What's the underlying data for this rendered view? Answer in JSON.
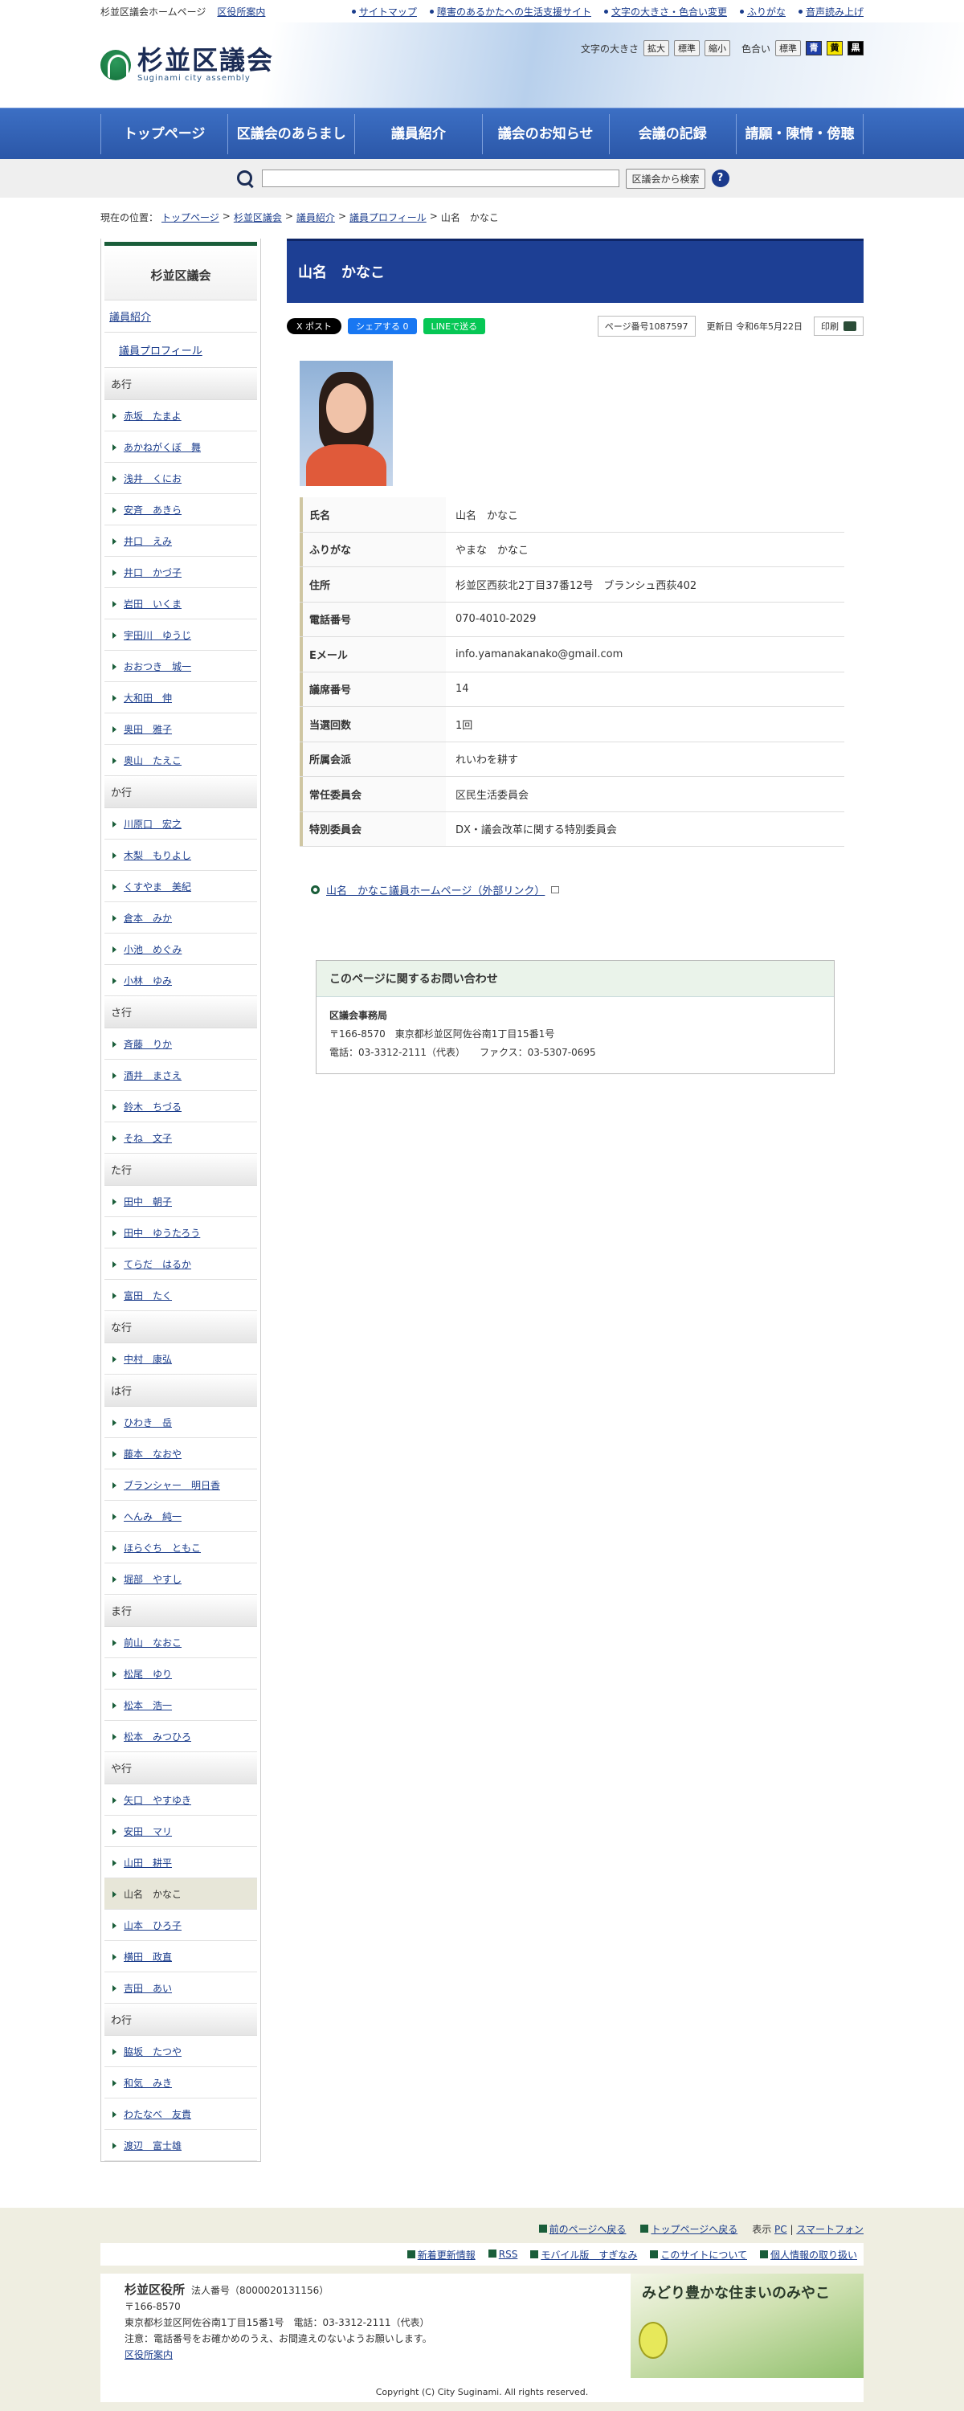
{
  "topbar": {
    "home": "杉並区議会ホームページ",
    "office": "区役所案内",
    "links": [
      "サイトマップ",
      "障害のあるかたへの生活支援サイト",
      "文字の大きさ・色合い変更",
      "ふりがな",
      "音声読み上げ"
    ]
  },
  "header": {
    "logo_title": "杉並区議会",
    "logo_sub": "Suginami city assembly",
    "fontsize_label": "文字の大きさ",
    "font_buttons": [
      "拡大",
      "標準",
      "縮小"
    ],
    "color_label": "色合い",
    "color_buttons": [
      "標準",
      "青",
      "黄",
      "黒"
    ]
  },
  "colors": {
    "nav_blue": "#2b57a8",
    "title_blue": "#1d3f94",
    "green": "#1a5e3a"
  },
  "nav": [
    "トップページ",
    "区議会のあらまし",
    "議員紹介",
    "議会のお知らせ",
    "会議の記録",
    "請願・陳情・傍聴"
  ],
  "search": {
    "button": "区議会から検索",
    "help": "?"
  },
  "breadcrumb": {
    "label": "現在の位置：",
    "items": [
      "トップページ",
      "杉並区議会",
      "議員紹介",
      "議員プロフィール"
    ],
    "current": "山名　かなこ"
  },
  "sidebar": {
    "title": "杉並区議会",
    "nav1": "議員紹介",
    "nav2": "議員プロフィール",
    "groups": [
      {
        "label": "あ行",
        "members": [
          "赤坂　たまよ",
          "あかねがくぼ　舞",
          "浅井　くにお",
          "安斉　あきら",
          "井口　えみ",
          "井口　かづ子",
          "岩田　いくま",
          "宇田川　ゆうじ",
          "おおつき　城一",
          "大和田　伸",
          "奥田　雅子",
          "奥山　たえこ"
        ]
      },
      {
        "label": "か行",
        "members": [
          "川原口　宏之",
          "木梨　もりよし",
          "くすやま　美紀",
          "倉本　みか",
          "小池　めぐみ",
          "小林　ゆみ"
        ]
      },
      {
        "label": "さ行",
        "members": [
          "斉藤　りか",
          "酒井　まさえ",
          "鈴木　ちづる",
          "そね　文子"
        ]
      },
      {
        "label": "た行",
        "members": [
          "田中　朝子",
          "田中　ゆうたろう",
          "てらだ　はるか",
          "富田　たく"
        ]
      },
      {
        "label": "な行",
        "members": [
          "中村　康弘"
        ]
      },
      {
        "label": "は行",
        "members": [
          "ひわき　岳",
          "藤本　なおや",
          "ブランシャー　明日香",
          "へんみ　純一",
          "ほらぐち　ともこ",
          "堀部　やすし"
        ]
      },
      {
        "label": "ま行",
        "members": [
          "前山　なおこ",
          "松尾　ゆり",
          "松本　浩一",
          "松本　みつひろ"
        ]
      },
      {
        "label": "や行",
        "members": [
          "矢口　やすゆき",
          "安田　マリ",
          "山田　耕平",
          "山名　かなこ",
          "山本　ひろ子",
          "横田　政直",
          "吉田　あい"
        ]
      },
      {
        "label": "わ行",
        "members": [
          "脇坂　たつや",
          "和気　みき",
          "わたなべ　友貴",
          "渡辺　富士雄"
        ]
      }
    ],
    "current": "山名　かなこ"
  },
  "main": {
    "title": "山名　かなこ",
    "share": {
      "x": "X ポスト",
      "fb": "シェアする 0",
      "line": "LINEで送る"
    },
    "page_no": "ページ番号1087597",
    "updated": "更新日 令和6年5月22日",
    "print": "印刷",
    "profile": [
      {
        "k": "氏名",
        "v": "山名　かなこ"
      },
      {
        "k": "ふりがな",
        "v": "やまな　かなこ"
      },
      {
        "k": "住所",
        "v": "杉並区西荻北2丁目37番12号　ブランシュ西荻402"
      },
      {
        "k": "電話番号",
        "v": "070-4010-2029"
      },
      {
        "k": "Eメール",
        "v": "info.yamanakanako@gmail.com"
      },
      {
        "k": "議席番号",
        "v": "14"
      },
      {
        "k": "当選回数",
        "v": "1回"
      },
      {
        "k": "所属会派",
        "v": "れいわを耕す"
      },
      {
        "k": "常任委員会",
        "v": "区民生活委員会"
      },
      {
        "k": "特別委員会",
        "v": "DX・議会改革に関する特別委員会"
      }
    ],
    "ext_link": "山名　かなこ議員ホームページ（外部リンク）",
    "contact": {
      "title": "このページに関するお問い合わせ",
      "org": "区議会事務局",
      "address": "〒166-8570　東京都杉並区阿佐谷南1丁目15番1号",
      "phone": "電話：03-3312-2111（代表）　　ファクス：03-5307-0695"
    }
  },
  "footer": {
    "nav1": [
      "前のページへ戻る",
      "トップページへ戻る"
    ],
    "display_label": "表示",
    "display_options": [
      "PC",
      "スマートフォン"
    ],
    "nav2": [
      "新着更新情報",
      "RSS",
      "モバイル版　すぎなみ",
      "このサイトについて",
      "個人情報の取り扱い"
    ],
    "org_name": "杉並区役所",
    "corp_no": "法人番号（8000020131156）",
    "postal": "〒166-8570",
    "address": "東京都杉並区阿佐谷南1丁目15番1号　電話：03-3312-2111（代表）",
    "note": "注意：電話番号をお確かめのうえ、お間違えのないようお願いします。",
    "office_link": "区役所案内",
    "banner_text": "みどり豊かな住まいのみやこ",
    "copyright": "Copyright (C) City Suginami. All rights reserved."
  }
}
